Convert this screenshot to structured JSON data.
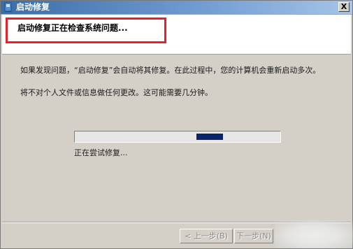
{
  "window": {
    "title": "启动修复",
    "close_label": "X"
  },
  "header": {
    "text": "启动修复正在检查系统问题..."
  },
  "body": {
    "para1": "如果发现问题，“启动修复”会自动将其修复。在此过程中，您的计算机会重新启动多次。",
    "para2": "将不对个人文件或信息做任何更改。这可能需要几分钟。",
    "status": "正在尝试修复..."
  },
  "progress": {
    "chunk_position": 0.68
  },
  "buttons": {
    "back_label": "< 上一步(B)",
    "next_label": "下一步(N)"
  },
  "colors": {
    "highlight_border": "#e8202a",
    "progress_fill": "#0a246a"
  }
}
